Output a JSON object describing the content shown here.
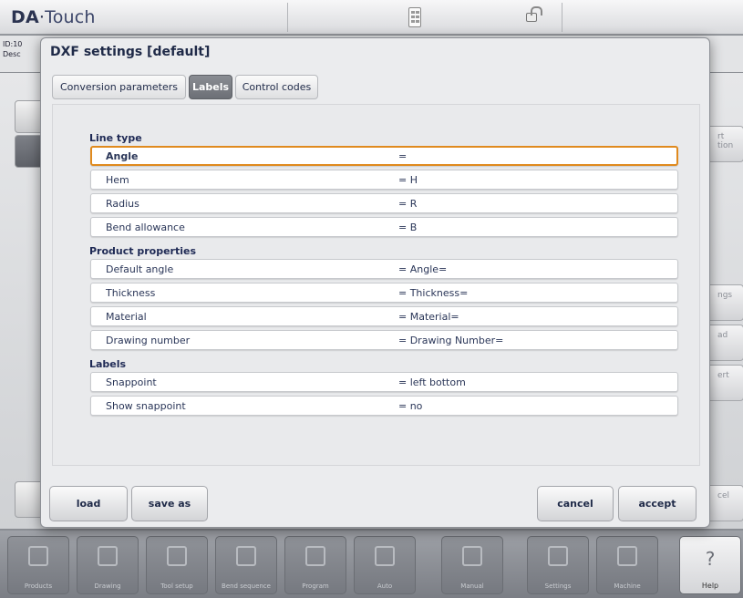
{
  "app": {
    "logo_da": "DA",
    "logo_touch": "Touch"
  },
  "background": {
    "id_line": "ID:10",
    "desc_line": "Desc",
    "right_buttons": [
      "rt",
      "tion",
      "ngs",
      "ad",
      "ert",
      "cel"
    ]
  },
  "dialog": {
    "title": "DXF settings [default]",
    "tabs": [
      {
        "label": "Conversion parameters",
        "active": false
      },
      {
        "label": "Labels",
        "active": true
      },
      {
        "label": "Control codes",
        "active": false
      }
    ],
    "sections": [
      {
        "heading": "Line type",
        "rows": [
          {
            "label": "Angle",
            "value": "=",
            "selected": true
          },
          {
            "label": "Hem",
            "value": "= H"
          },
          {
            "label": "Radius",
            "value": "= R"
          },
          {
            "label": "Bend allowance",
            "value": "= B"
          }
        ]
      },
      {
        "heading": "Product properties",
        "rows": [
          {
            "label": "Default angle",
            "value": "= Angle="
          },
          {
            "label": "Thickness",
            "value": "= Thickness="
          },
          {
            "label": "Material",
            "value": "= Material="
          },
          {
            "label": "Drawing number",
            "value": "= Drawing Number="
          }
        ]
      },
      {
        "heading": "Labels",
        "rows": [
          {
            "label": "Snappoint",
            "value": "= left bottom"
          },
          {
            "label": "Show snappoint",
            "value": "= no"
          }
        ]
      }
    ],
    "buttons": {
      "load": "load",
      "save_as": "save as",
      "cancel": "cancel",
      "accept": "accept"
    }
  },
  "nav": [
    {
      "label": "Products",
      "icon": "folder-icon"
    },
    {
      "label": "Drawing",
      "icon": "drawing-icon"
    },
    {
      "label": "Tool setup",
      "icon": "tool-setup-icon"
    },
    {
      "label": "Bend sequence",
      "icon": "bend-sequence-icon"
    },
    {
      "label": "Program",
      "icon": "program-icon"
    },
    {
      "label": "Auto",
      "icon": "play-icon"
    },
    {
      "label": "Manual",
      "icon": "hand-icon"
    },
    {
      "label": "Settings",
      "icon": "settings-icon"
    },
    {
      "label": "Machine",
      "icon": "machine-icon"
    },
    {
      "label": "Help",
      "icon": "help-icon"
    }
  ],
  "colors": {
    "selection": "#e08a1e",
    "accent_text": "#1f2a55"
  }
}
